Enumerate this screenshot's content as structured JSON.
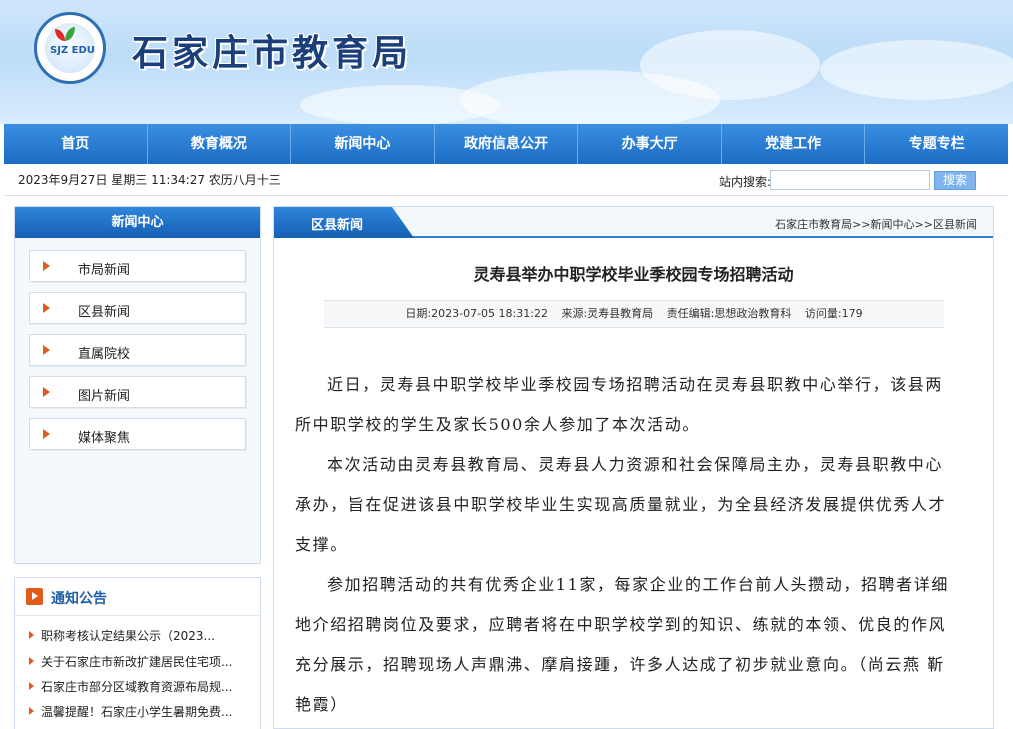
{
  "header": {
    "site_title": "石家庄市教育局",
    "logo_text": "SJZ EDU"
  },
  "nav": {
    "items": [
      "首页",
      "教育概况",
      "新闻中心",
      "政府信息公开",
      "办事大厅",
      "党建工作",
      "专题专栏"
    ]
  },
  "infobar": {
    "datetime": "2023年9月27日 星期三 11:34:27 农历八月十三",
    "search_label": "站内搜索:",
    "search_value": "",
    "search_button": "搜索"
  },
  "sidebar": {
    "title": "新闻中心",
    "items": [
      "市局新闻",
      "区县新闻",
      "直属院校",
      "图片新闻",
      "媒体聚焦"
    ]
  },
  "notices": {
    "title": "通知公告",
    "items": [
      "职称考核认定结果公示（2023...",
      "关于石家庄市新改扩建居民住宅项...",
      "石家庄市部分区域教育资源布局规...",
      "温馨提醒！石家庄小学生暑期免费..."
    ]
  },
  "main": {
    "tab": "区县新闻",
    "breadcrumb": "石家庄市教育局>>新闻中心>>区县新闻",
    "title": "灵寿县举办中职学校毕业季校园专场招聘活动",
    "meta": {
      "date": "日期:2023-07-05 18:31:22",
      "source": "来源:灵寿县教育局",
      "editor": "责任编辑:思想政治教育科",
      "views": "访问量:179"
    },
    "paragraphs": [
      "近日，灵寿县中职学校毕业季校园专场招聘活动在灵寿县职教中心举行，该县两所中职学校的学生及家长500余人参加了本次活动。",
      "本次活动由灵寿县教育局、灵寿县人力资源和社会保障局主办，灵寿县职教中心承办，旨在促进该县中职学校毕业生实现高质量就业，为全县经济发展提供优秀人才支撑。",
      "参加招聘活动的共有优秀企业11家，每家企业的工作台前人头攒动，招聘者详细地介绍招聘岗位及要求，应聘者将在中职学校学到的知识、练就的本领、优良的作风充分展示，招聘现场人声鼎沸、摩肩接踵，许多人达成了初步就业意向。（尚云燕 靳艳霞）"
    ]
  }
}
